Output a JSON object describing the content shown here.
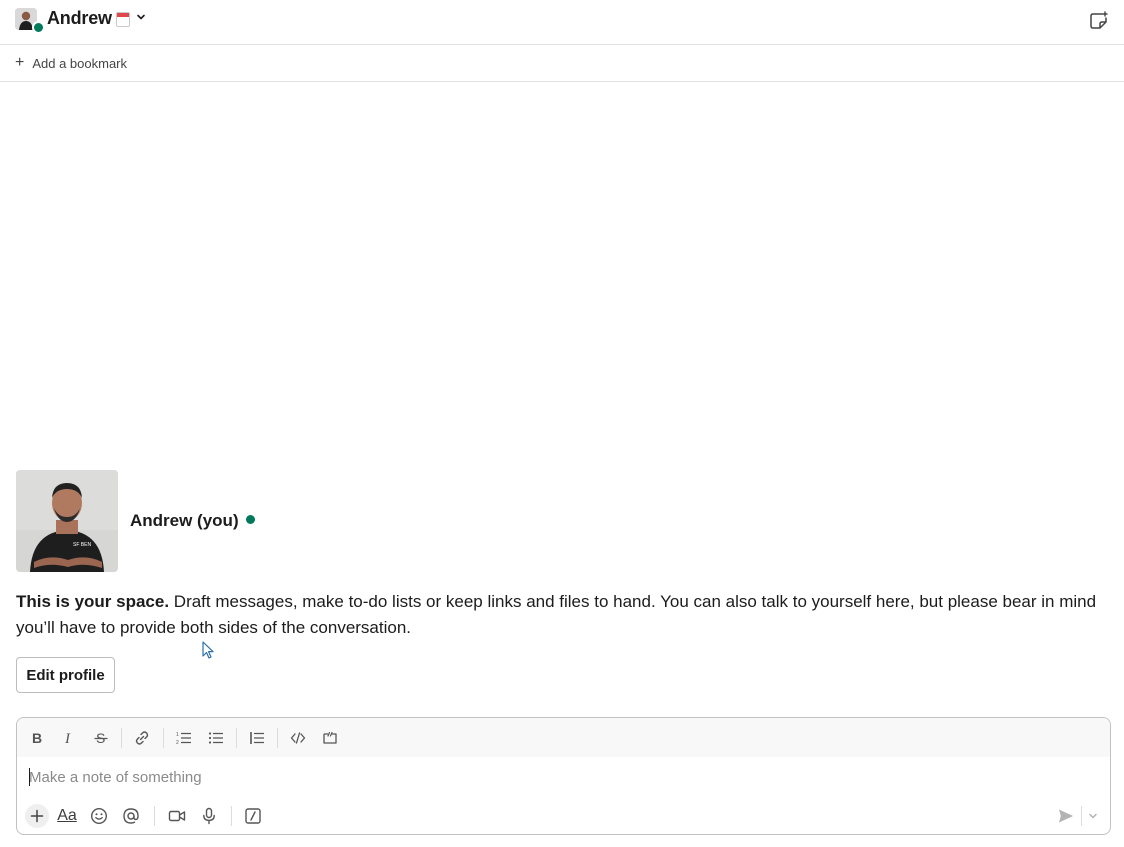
{
  "header": {
    "title": "Andrew",
    "status_emoji": "calendar-icon",
    "presence": "active"
  },
  "bookmarks": {
    "add_label": "Add a bookmark"
  },
  "intro": {
    "name": "Andrew (you)",
    "lead": "This is your space.",
    "body": " Draft messages, make to-do lists or keep links and files to hand. You can also talk to yourself here, but please bear in mind you’ll have to provide both sides of the conversation.",
    "edit_profile_label": "Edit profile"
  },
  "composer": {
    "placeholder": "Make a note of something",
    "value": "",
    "format_label": "Aa",
    "toolbar": [
      "bold-icon",
      "italic-icon",
      "strikethrough-icon",
      "link-icon",
      "ordered-list-icon",
      "bullet-list-icon",
      "blockquote-icon",
      "code-icon",
      "code-block-icon"
    ],
    "actions": [
      "plus-icon",
      "formatting-icon",
      "emoji-icon",
      "mention-icon",
      "video-icon",
      "microphone-icon",
      "slash-command-icon",
      "send-icon",
      "chevron-down-icon"
    ]
  },
  "colors": {
    "presence": "#007a5a",
    "border": "#e2e2e2",
    "toolbar_bg": "#f8f8f8",
    "text": "#1d1c1d"
  }
}
